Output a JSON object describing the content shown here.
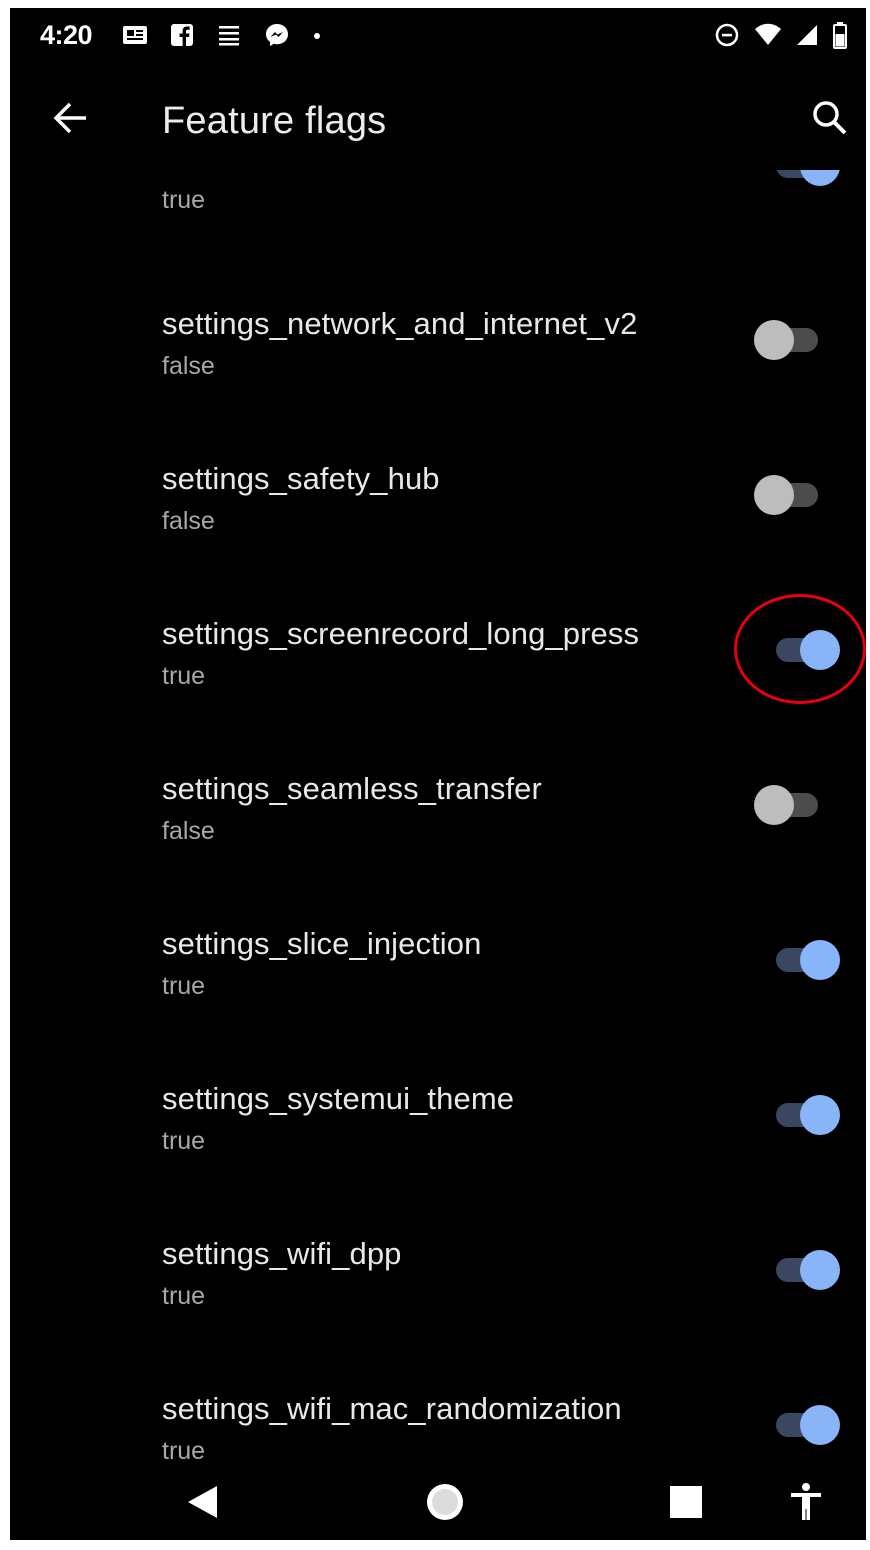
{
  "status_bar": {
    "time": "4:20",
    "left_icons": [
      "news-icon",
      "facebook-icon",
      "menu-lines-icon",
      "messenger-icon",
      "dot-icon"
    ],
    "right_icons": [
      "do-not-disturb-icon",
      "wifi-icon",
      "cell-signal-icon",
      "battery-icon"
    ]
  },
  "app_bar": {
    "title": "Feature flags",
    "back_icon": "arrow-left-icon",
    "search_icon": "search-icon"
  },
  "flags": [
    {
      "name": "",
      "value": "true",
      "enabled": true
    },
    {
      "name": "settings_network_and_internet_v2",
      "value": "false",
      "enabled": false
    },
    {
      "name": "settings_safety_hub",
      "value": "false",
      "enabled": false
    },
    {
      "name": "settings_screenrecord_long_press",
      "value": "true",
      "enabled": true,
      "highlighted": true
    },
    {
      "name": "settings_seamless_transfer",
      "value": "false",
      "enabled": false
    },
    {
      "name": "settings_slice_injection",
      "value": "true",
      "enabled": true
    },
    {
      "name": "settings_systemui_theme",
      "value": "true",
      "enabled": true
    },
    {
      "name": "settings_wifi_dpp",
      "value": "true",
      "enabled": true
    },
    {
      "name": "settings_wifi_mac_randomization",
      "value": "true",
      "enabled": true
    }
  ],
  "nav_bar": {
    "buttons": [
      "back-triangle-icon",
      "home-circle-icon",
      "recents-square-icon",
      "accessibility-icon"
    ]
  },
  "colors": {
    "background": "#000000",
    "switch_on_thumb": "#8ab4f8",
    "switch_off_thumb": "#bdbdbd",
    "highlight": "#e4000f"
  }
}
